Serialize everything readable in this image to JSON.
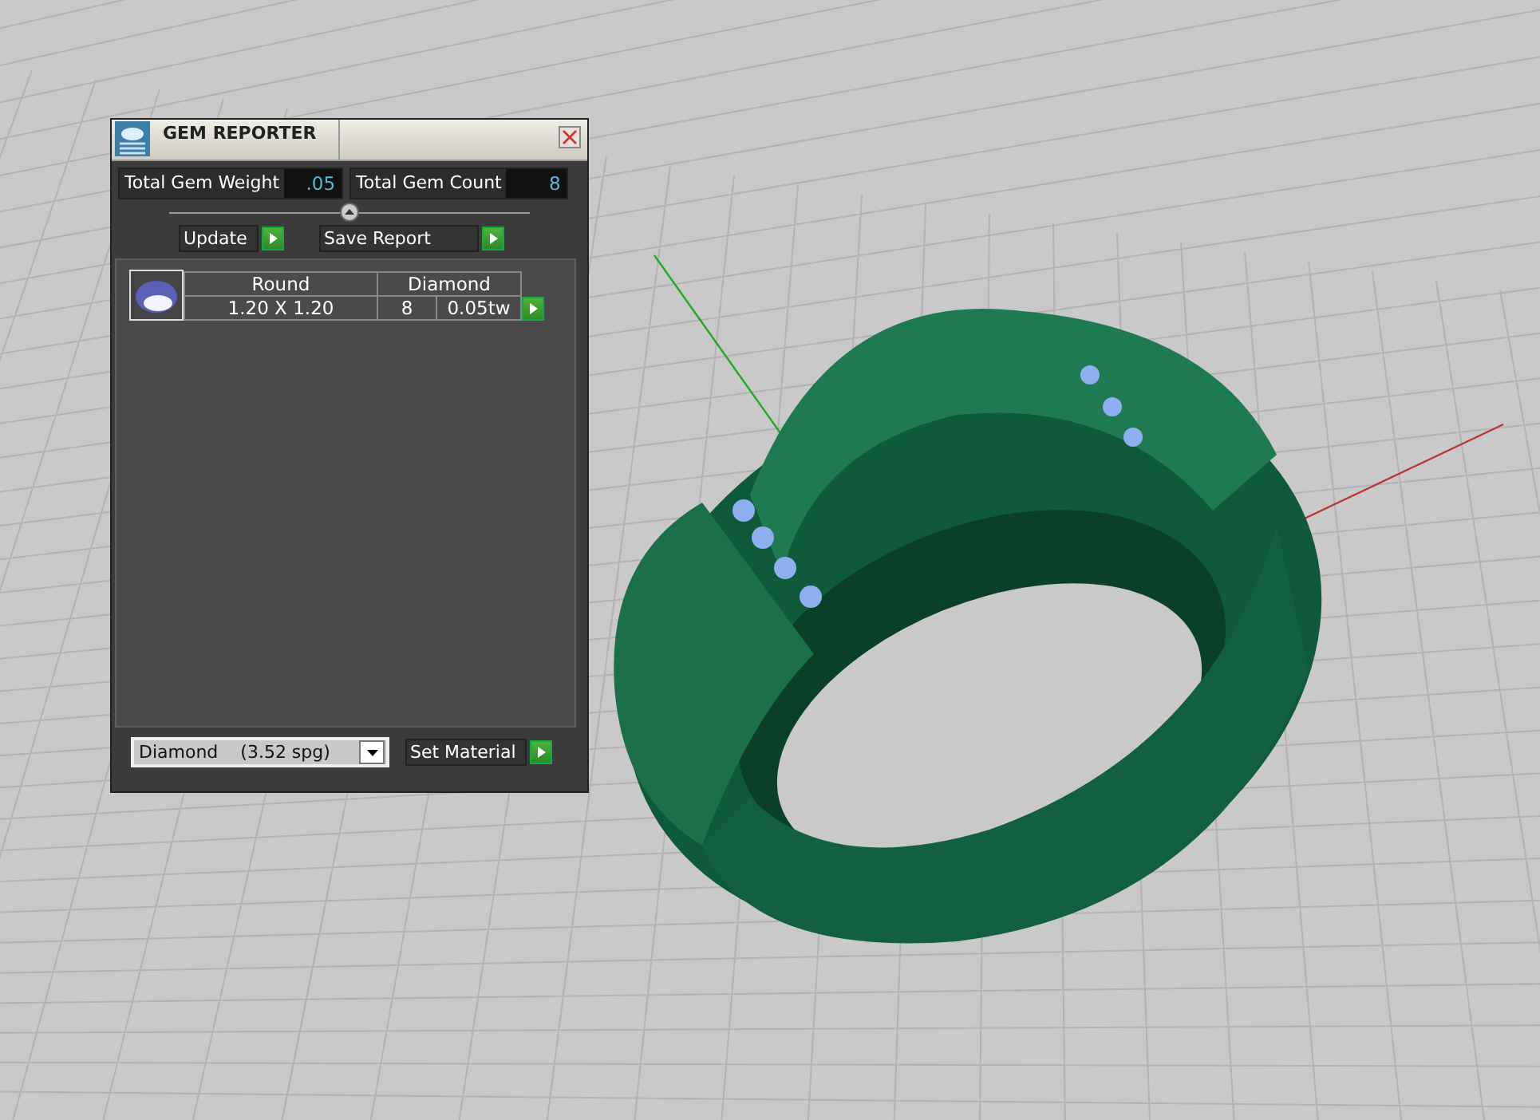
{
  "dialog": {
    "title": "GEM REPORTER",
    "totals": [
      {
        "label": "Total Gem Weight",
        "value": ".05"
      },
      {
        "label": "Total Gem Count",
        "value": "8"
      }
    ],
    "buttons": [
      {
        "label": "Update"
      },
      {
        "label": "Save Report"
      }
    ],
    "gems": [
      {
        "shape": "Round",
        "size": "1.20 X 1.20",
        "material": "Diamond",
        "count": "8",
        "weight": "0.05tw"
      }
    ],
    "material_select": {
      "value": "Diamond    (3.52 spg)"
    },
    "set_material": {
      "label": "Set Material"
    }
  }
}
